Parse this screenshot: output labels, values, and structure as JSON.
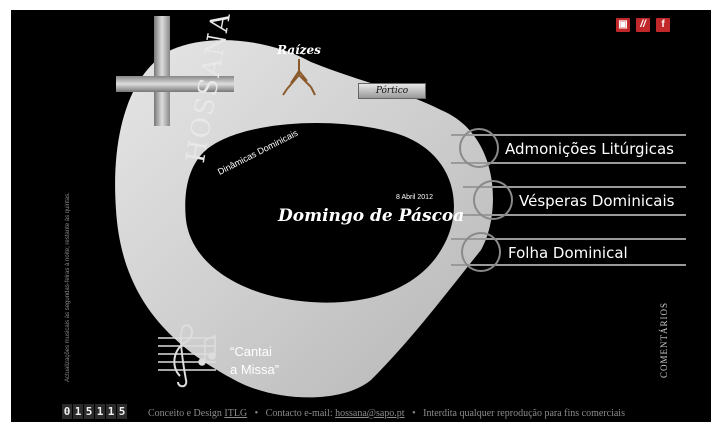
{
  "social": {
    "icon1": "▣",
    "icon2": "//",
    "icon3": "f",
    "icon1_name": "blog-icon",
    "icon2_name": "slash-icon",
    "icon3_name": "facebook-icon"
  },
  "logo_text": "HOSSANA",
  "raizes": "Raízes",
  "portico": "Pórtico",
  "dinamicas": "Dinâmicas Dominicais",
  "date": "8 Abril 2012",
  "headline": "Domingo de Páscoa",
  "menu": [
    {
      "label": "Admonições Litúrgicas"
    },
    {
      "label": "Vésperas Dominicais"
    },
    {
      "label": "Folha Dominical"
    }
  ],
  "cantai": {
    "line1": "“Cantai",
    "line2": "a Missa”"
  },
  "side_note": "Actualizações musicais às segundas-feiras à noite; restante às quintas.",
  "comentarios": "Comentários",
  "counter_digits": [
    "0",
    "1",
    "5",
    "1",
    "1",
    "5"
  ],
  "footer": {
    "concept": "Conceito e Design",
    "concept_link": "ITLG",
    "sep1": "•",
    "contact": "Contacto e-mail:",
    "email": "hossana@sapo.pt",
    "sep2": "•",
    "rights": "Interdita qualquer reprodução para fins comerciais"
  },
  "colors": {
    "accent_red": "#c0282a",
    "background": "#000000",
    "ring": "#d9d9d9"
  }
}
